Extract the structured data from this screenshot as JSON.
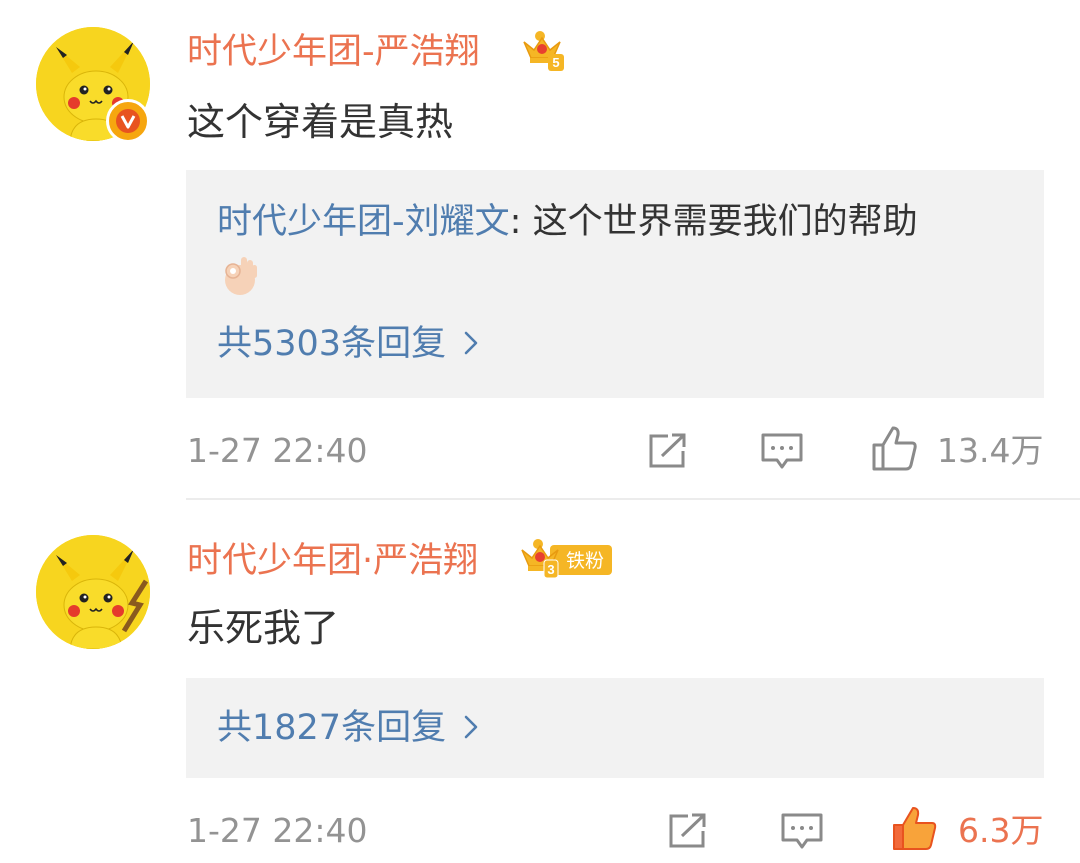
{
  "comments": [
    {
      "username": "时代少年团-严浩翔",
      "member_level": "5",
      "text": "这个穿着是真热",
      "reply_preview": {
        "author": "时代少年团-刘耀文",
        "separator": ": ",
        "text": "这个世界需要我们的帮助"
      },
      "reply_count_label": "共5303条回复",
      "time": "1-27 22:40",
      "likes": "13.4万",
      "liked": false
    },
    {
      "username": "时代少年团·严浩翔",
      "member_level": "3",
      "fan_badge": "铁粉",
      "text": "乐死我了",
      "reply_count_label": "共1827条回复",
      "time": "1-27 22:40",
      "likes": "6.3万",
      "liked": true
    }
  ],
  "colors": {
    "username": "#eb7350",
    "link": "#507daf",
    "text": "#333333",
    "muted": "#939393",
    "reply_bg": "#f2f2f2",
    "liked": "#eb7350",
    "avatar_bg": "#f7d51f"
  },
  "icons": [
    "pikachu-avatar",
    "verified-v-icon",
    "vip-crown-icon",
    "ok-hand-emoji",
    "chevron-right-icon",
    "repost-icon",
    "comment-icon",
    "like-icon"
  ]
}
